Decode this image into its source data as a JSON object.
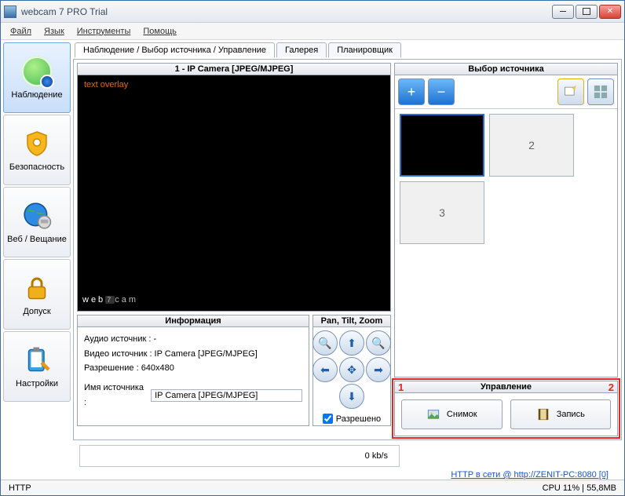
{
  "window": {
    "title": "webcam 7 PRO Trial"
  },
  "menu": {
    "file": "Файл",
    "lang": "Язык",
    "tools": "Инструменты",
    "help": "Помощь"
  },
  "sidebar": {
    "items": [
      {
        "label": "Наблюдение"
      },
      {
        "label": "Безопасность"
      },
      {
        "label": "Веб / Вещание"
      },
      {
        "label": "Допуск"
      },
      {
        "label": "Настройки"
      }
    ]
  },
  "tabs": {
    "monitor": "Наблюдение / Выбор источника / Управление",
    "gallery": "Галерея",
    "scheduler": "Планировщик"
  },
  "video": {
    "title": "1 - IP Camera [JPEG/MJPEG]",
    "overlay": "text overlay",
    "wm_prefix": "web",
    "wm_suffix": "cam",
    "wm_badge": "7"
  },
  "info": {
    "title": "Информация",
    "audio_label": "Аудио источник : -",
    "video_label": "Видео источник : IP Camera [JPEG/MJPEG]",
    "res_label": "Разрешение : 640x480",
    "name_label": "Имя источника :",
    "name_value": "IP Camera [JPEG/MJPEG]"
  },
  "ptz": {
    "title": "Pan, Tilt, Zoom",
    "allowed": "Разрешено"
  },
  "sources": {
    "title": "Выбор источника",
    "slot2": "2",
    "slot3": "3"
  },
  "control": {
    "title": "Управление",
    "snapshot": "Снимок",
    "record": "Запись",
    "callout1": "1",
    "callout2": "2"
  },
  "speed": {
    "label": "0 kb/s"
  },
  "link": {
    "text": "HTTP в сети @ http://ZENIT-PC:8080 [0]"
  },
  "status": {
    "left": "HTTP",
    "right": "CPU 11% | 55,8MB"
  }
}
